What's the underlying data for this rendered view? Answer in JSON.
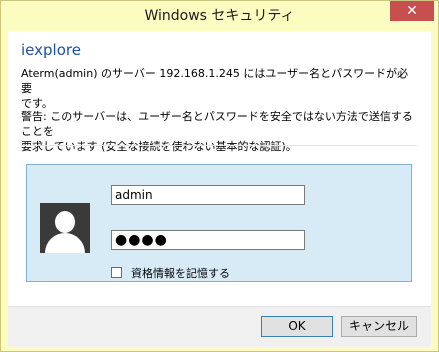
{
  "window": {
    "title": "Windows セキュリティ",
    "close_label": "✕"
  },
  "dialog": {
    "app_name": "iexplore",
    "message": "Aterm(admin) のサーバー 192.168.1.245 にはユーザー名とパスワードが必要\nです。",
    "warning": "警告: このサーバーは、ユーザー名とパスワードを安全ではない方法で送信することを\n要求しています (安全な接続を使わない基本的な認証)。"
  },
  "credentials": {
    "username": "admin",
    "password_mask": "●●●●",
    "remember_label": "資格情報を記憶する",
    "remember_checked": false
  },
  "buttons": {
    "ok": "OK",
    "cancel": "キャンセル"
  },
  "colors": {
    "title_bar": "#fdfcc0",
    "app_name": "#1e50a2",
    "panel": "#d7ebf7",
    "close": "#c74f4f"
  },
  "icons": {
    "avatar": "user-silhouette-icon",
    "close": "close-icon"
  }
}
